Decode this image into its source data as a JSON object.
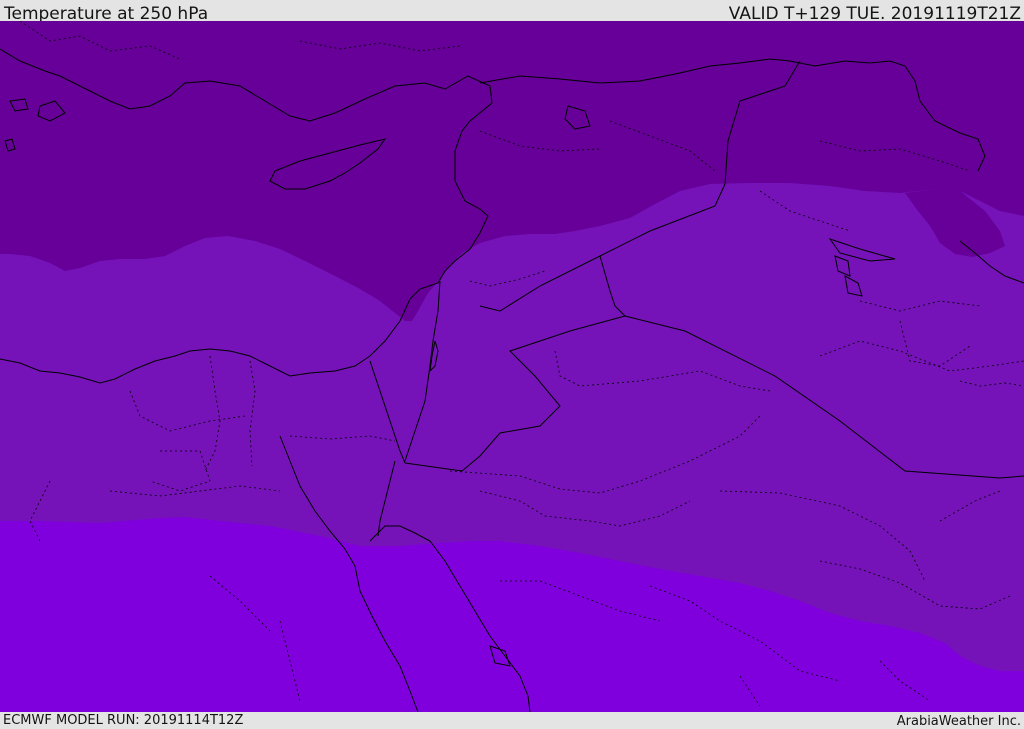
{
  "header": {
    "title": "Temperature at 250 hPa",
    "valid": "VALID T+129 TUE. 20191119T21Z"
  },
  "footer": {
    "model_run": "ECMWF MODEL RUN: 20191114T12Z",
    "credit": "ArabiaWeather Inc."
  },
  "colors": {
    "band_coldest": "#660099",
    "band_cold": "#7513b8",
    "band_mild": "#8000dd",
    "coastline": "#000000",
    "border": "#000000",
    "background": "#e4e4e4"
  }
}
